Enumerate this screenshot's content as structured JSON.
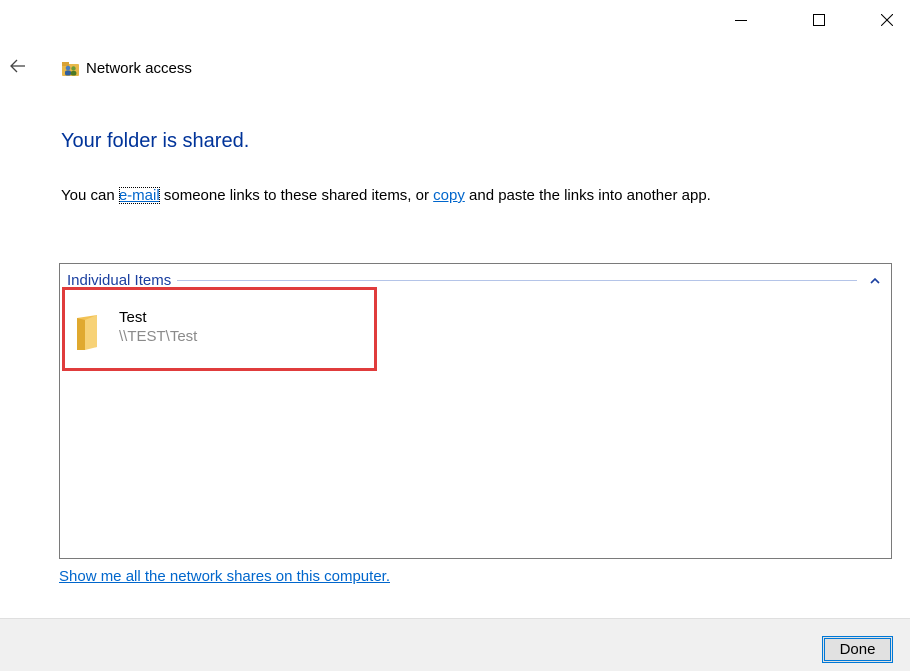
{
  "window": {
    "title": "Network access"
  },
  "heading": "Your folder is shared.",
  "description": {
    "part1": "You can ",
    "email_link": "e-mail",
    "part2": " someone links to these shared items, or ",
    "copy_link": "copy",
    "part3": " and paste the links into another app."
  },
  "items_group": {
    "label": "Individual Items",
    "items": [
      {
        "name": "Test",
        "path": "\\\\TEST\\Test"
      }
    ]
  },
  "shares_link": "Show me all the network shares on this computer.",
  "footer": {
    "done_label": "Done"
  },
  "colors": {
    "heading": "#003399",
    "link": "#0066cc",
    "highlight": "#e03c3c",
    "button_border": "#0078d7"
  },
  "icons": {
    "back": "back-arrow-icon",
    "title": "network-sharing-icon",
    "folder": "folder-icon",
    "collapse": "chevron-up-icon"
  }
}
